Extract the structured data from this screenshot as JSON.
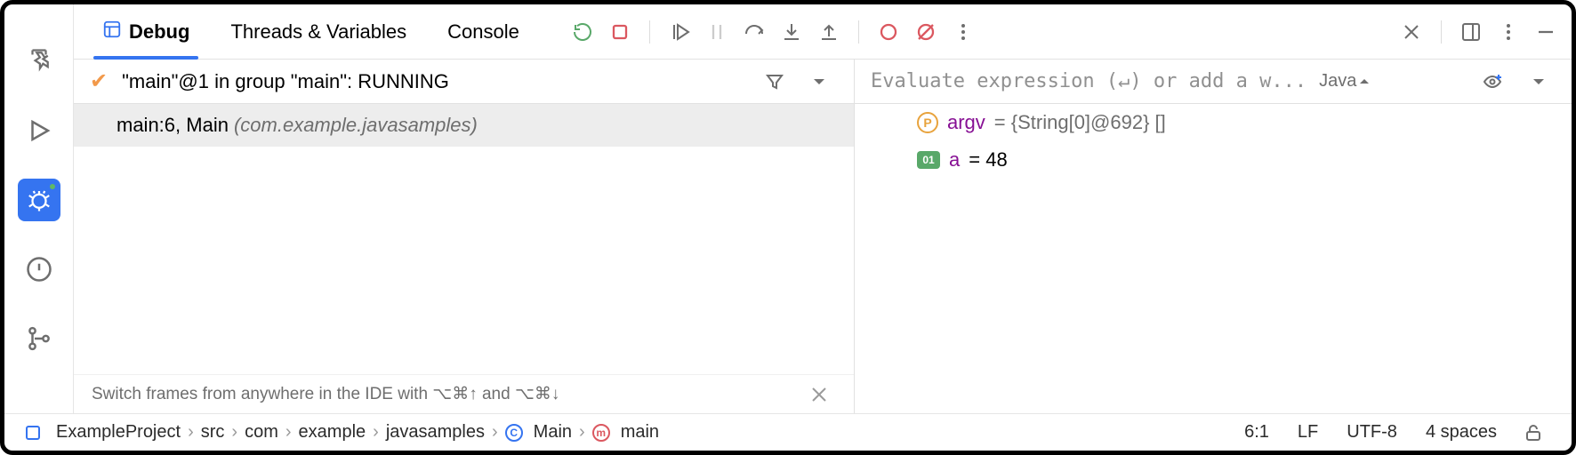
{
  "tabs": {
    "debug": "Debug",
    "threads": "Threads & Variables",
    "console": "Console"
  },
  "thread_header": "\"main\"@1 in group \"main\": RUNNING",
  "frame": {
    "location": "main:6, Main",
    "package": "(com.example.javasamples)"
  },
  "hint": "Switch frames from anywhere in the IDE with ⌥⌘↑ and ⌥⌘↓",
  "eval_placeholder": "Evaluate expression (↵) or add a w...",
  "scope_chip": "Java",
  "vars": [
    {
      "icon": "p",
      "name": "argv",
      "value": "= {String[0]@692} []"
    },
    {
      "icon": "i",
      "name": "a",
      "value": "= 48"
    }
  ],
  "breadcrumbs": [
    "ExampleProject",
    "src",
    "com",
    "example",
    "javasamples",
    "Main",
    "main"
  ],
  "status": {
    "pos": "6:1",
    "eol": "LF",
    "enc": "UTF-8",
    "indent": "4 spaces"
  }
}
